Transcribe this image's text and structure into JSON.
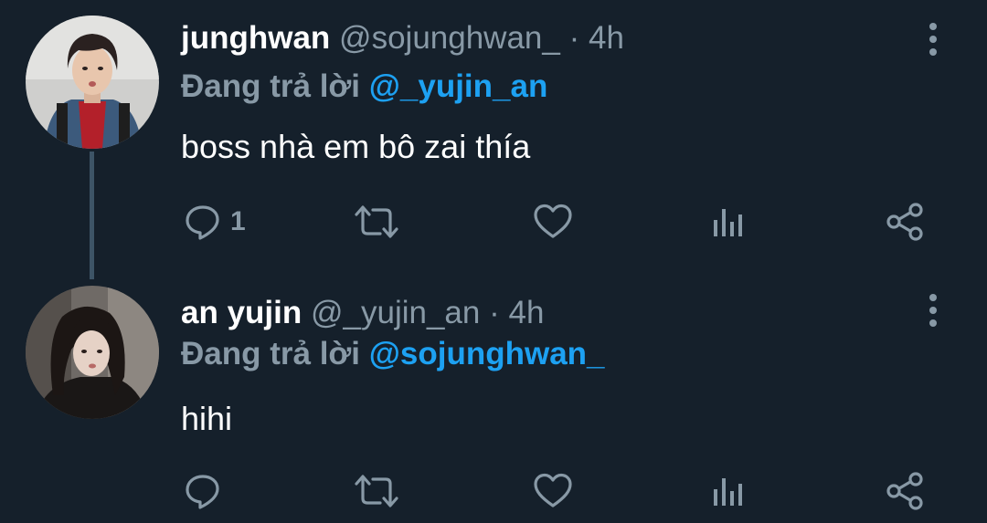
{
  "colors": {
    "background": "#15202b",
    "secondary_text": "#8899a6",
    "link": "#1da1f2",
    "thread_line": "#3d5466",
    "icon": "#8899a6"
  },
  "tweets": [
    {
      "display_name": "junghwan",
      "handle": "@sojunghwan_",
      "separator": "·",
      "time": "4h",
      "reply_prefix": "Đang trả lời",
      "reply_to": "@_yujin_an",
      "text": "boss nhà em bô zai thía",
      "reply_count": "1",
      "icons": [
        "reply-icon",
        "retweet-icon",
        "like-icon",
        "stats-icon",
        "share-icon",
        "more-icon"
      ]
    },
    {
      "display_name": "an yujin",
      "handle": "@_yujin_an",
      "separator": "·",
      "time": "4h",
      "reply_prefix": "Đang trả lời",
      "reply_to": "@sojunghwan_",
      "text": "hihi",
      "reply_count": "",
      "icons": [
        "reply-icon",
        "retweet-icon",
        "like-icon",
        "stats-icon",
        "share-icon",
        "more-icon"
      ]
    }
  ]
}
